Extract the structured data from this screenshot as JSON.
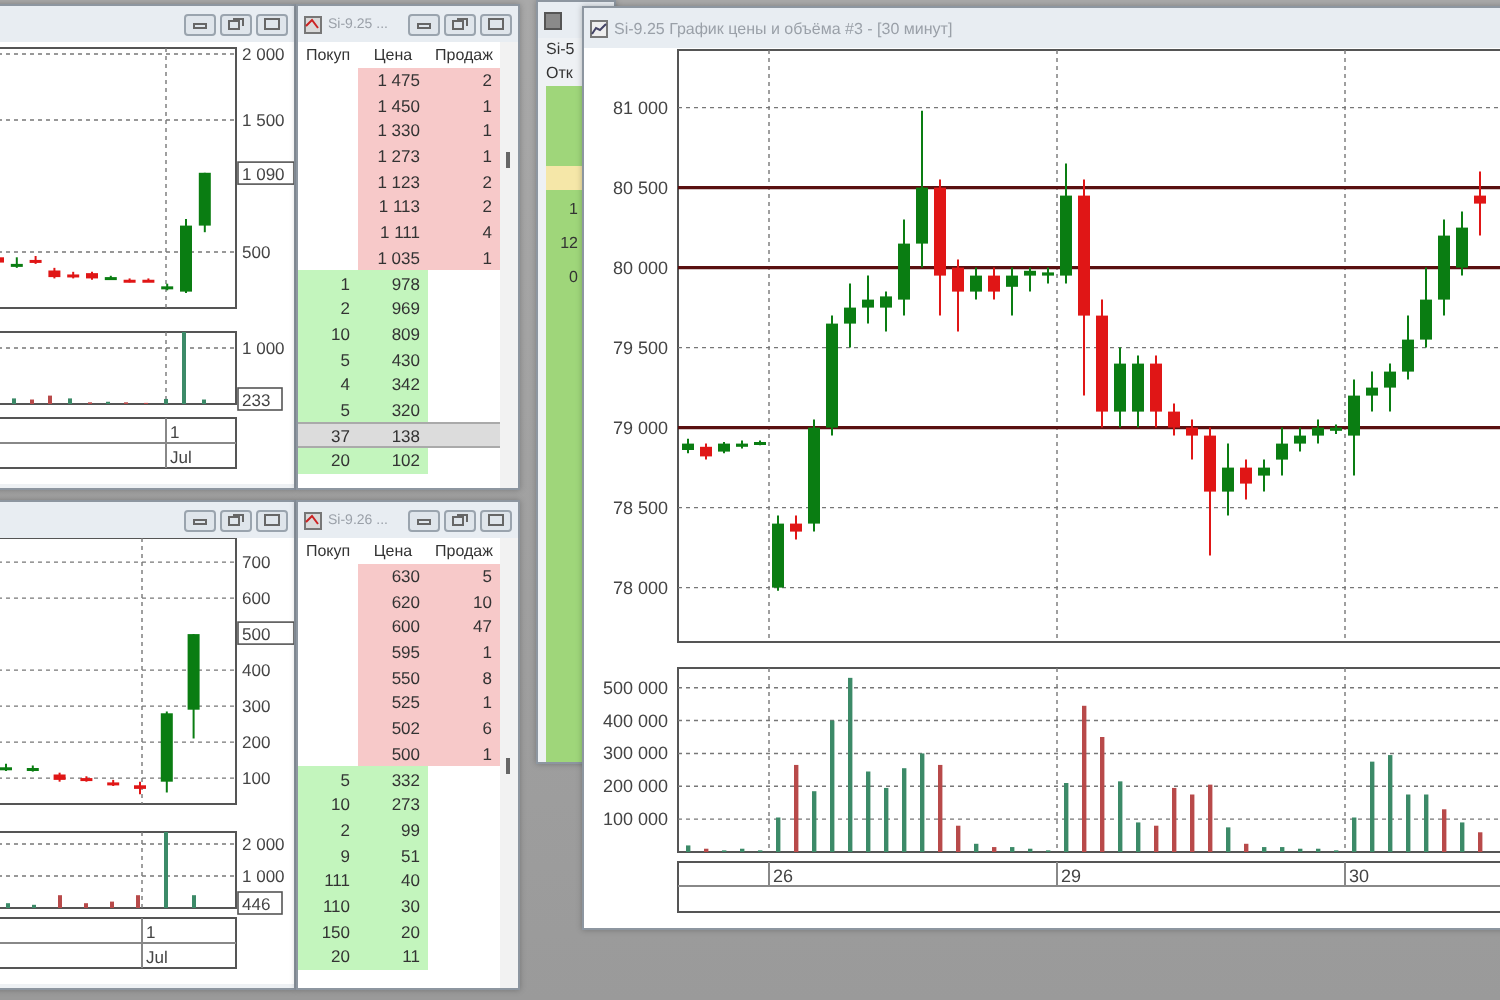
{
  "chart_windows": [
    {
      "chart_data": {
        "type": "candlestick",
        "grid": true,
        "categories": [
          null,
          null,
          null,
          null,
          null,
          null,
          null,
          null,
          null,
          null,
          null,
          null
        ],
        "ylim": [
          76,
          2045
        ],
        "yticks": [
          {
            "value": 2000,
            "label": "2 000"
          },
          {
            "value": 1500,
            "label": "1 500"
          },
          {
            "value": 500,
            "label": "500"
          }
        ],
        "ohlc": [
          [
            460,
            480,
            400,
            420
          ],
          [
            400,
            460,
            380,
            410
          ],
          [
            440,
            470,
            410,
            420
          ],
          [
            360,
            380,
            300,
            310
          ],
          [
            330,
            350,
            300,
            310
          ],
          [
            340,
            350,
            290,
            300
          ],
          [
            300,
            320,
            300,
            310
          ],
          [
            290,
            300,
            270,
            280
          ],
          [
            290,
            300,
            275,
            280
          ],
          [
            230,
            260,
            210,
            240
          ],
          [
            200,
            750,
            190,
            700
          ],
          [
            700,
            1100,
            650,
            1100
          ]
        ]
      },
      "last_price": "1 090",
      "volume_axis": [
        "1 000"
      ],
      "last_volume": "233",
      "date_labels": [
        "1",
        "Jul"
      ]
    },
    {
      "chart_data": {
        "type": "candlestick",
        "grid": true,
        "categories": [
          null,
          null,
          null,
          null,
          null,
          null,
          null,
          null
        ],
        "ylim": [
          28,
          767
        ],
        "yticks": [
          {
            "value": 700,
            "label": "700"
          },
          {
            "value": 600,
            "label": "600"
          },
          {
            "value": 400,
            "label": "400"
          },
          {
            "value": 300,
            "label": "300"
          },
          {
            "value": 200,
            "label": "200"
          },
          {
            "value": 100,
            "label": "100"
          }
        ],
        "ohlc": [
          [
            125,
            140,
            120,
            130
          ],
          [
            122,
            135,
            118,
            128
          ],
          [
            110,
            115,
            90,
            95
          ],
          [
            100,
            105,
            90,
            95
          ],
          [
            88,
            95,
            78,
            85
          ],
          [
            80,
            90,
            55,
            70
          ],
          [
            90,
            285,
            60,
            280
          ],
          [
            290,
            500,
            210,
            500
          ]
        ]
      },
      "last_price": "500",
      "volume_axis": [
        "2 000",
        "1 000"
      ],
      "last_volume": "446",
      "date_labels": [
        "1",
        "Jul"
      ]
    }
  ],
  "order_books": [
    {
      "title": "Si-9.25 ...",
      "columns": [
        "Покуп",
        "Цена",
        "Продаж"
      ],
      "rows": [
        {
          "kind": "ask",
          "price": "1 475",
          "sell": "2",
          "selected": false
        },
        {
          "kind": "ask",
          "price": "1 450",
          "sell": "1",
          "selected": false
        },
        {
          "kind": "ask",
          "price": "1 330",
          "sell": "1",
          "selected": false
        },
        {
          "kind": "ask",
          "price": "1 273",
          "sell": "1",
          "selected": false
        },
        {
          "kind": "ask",
          "price": "1 123",
          "sell": "2",
          "selected": false
        },
        {
          "kind": "ask",
          "price": "1 113",
          "sell": "2",
          "selected": false
        },
        {
          "kind": "ask",
          "price": "1 111",
          "sell": "4",
          "selected": false
        },
        {
          "kind": "ask",
          "price": "1 035",
          "sell": "1",
          "selected": false
        },
        {
          "kind": "bid",
          "buy": "1",
          "price": "978",
          "selected": false
        },
        {
          "kind": "bid",
          "buy": "2",
          "price": "969",
          "selected": false
        },
        {
          "kind": "bid",
          "buy": "10",
          "price": "809",
          "selected": false
        },
        {
          "kind": "bid",
          "buy": "5",
          "price": "430",
          "selected": false
        },
        {
          "kind": "bid",
          "buy": "4",
          "price": "342",
          "selected": false
        },
        {
          "kind": "bid",
          "buy": "5",
          "price": "320",
          "selected": false
        },
        {
          "kind": "bid",
          "buy": "37",
          "price": "138",
          "selected": true
        },
        {
          "kind": "bid",
          "buy": "20",
          "price": "102",
          "selected": false
        }
      ]
    },
    {
      "title": "Si-9.26 ...",
      "columns": [
        "Покуп",
        "Цена",
        "Продаж"
      ],
      "rows": [
        {
          "kind": "ask",
          "price": "630",
          "sell": "5",
          "selected": false
        },
        {
          "kind": "ask",
          "price": "620",
          "sell": "10",
          "selected": false
        },
        {
          "kind": "ask",
          "price": "600",
          "sell": "47",
          "selected": false
        },
        {
          "kind": "ask",
          "price": "595",
          "sell": "1",
          "selected": false
        },
        {
          "kind": "ask",
          "price": "550",
          "sell": "8",
          "selected": false
        },
        {
          "kind": "ask",
          "price": "525",
          "sell": "1",
          "selected": false
        },
        {
          "kind": "ask",
          "price": "502",
          "sell": "6",
          "selected": false
        },
        {
          "kind": "ask",
          "price": "500",
          "sell": "1",
          "selected": false
        },
        {
          "kind": "bid",
          "buy": "5",
          "price": "332",
          "selected": false
        },
        {
          "kind": "bid",
          "buy": "10",
          "price": "273",
          "selected": false
        },
        {
          "kind": "bid",
          "buy": "2",
          "price": "99",
          "selected": false
        },
        {
          "kind": "bid",
          "buy": "9",
          "price": "51",
          "selected": false
        },
        {
          "kind": "bid",
          "buy": "111",
          "price": "40",
          "selected": false
        },
        {
          "kind": "bid",
          "buy": "110",
          "price": "30",
          "selected": false
        },
        {
          "kind": "bid",
          "buy": "150",
          "price": "20",
          "selected": false
        },
        {
          "kind": "bid",
          "buy": "20",
          "price": "11",
          "selected": false
        }
      ]
    }
  ],
  "back_window": {
    "title": "Si-5",
    "header": "Отк",
    "cells": [
      "1",
      "12",
      "0"
    ]
  },
  "main_chart": {
    "title": "Si-9.25 График цены и объёма #3 - [30 минут]",
    "price": {
      "chart_data": {
        "type": "candlestick",
        "grid": true,
        "categories": [
          null,
          null,
          null,
          null,
          null,
          null,
          null,
          null,
          null,
          null,
          null,
          null,
          null,
          null,
          null,
          null,
          null,
          null,
          null,
          null,
          null,
          null,
          null,
          null,
          null,
          null,
          null,
          null,
          null,
          null,
          null,
          null,
          null,
          null,
          null,
          null,
          null,
          null,
          null,
          null,
          null,
          null,
          null,
          null,
          null
        ],
        "ylim": [
          77660,
          81360
        ],
        "yticks": [
          {
            "value": 81000,
            "label": "81 000"
          },
          {
            "value": 80500,
            "label": "80 500"
          },
          {
            "value": 80000,
            "label": "80 000"
          },
          {
            "value": 79500,
            "label": "79 500"
          },
          {
            "value": 79000,
            "label": "79 000"
          },
          {
            "value": 78500,
            "label": "78 500"
          },
          {
            "value": 78000,
            "label": "78 000"
          }
        ],
        "ohlc": [
          [
            78860,
            78930,
            78840,
            78900
          ],
          [
            78880,
            78900,
            78800,
            78820
          ],
          [
            78850,
            78910,
            78840,
            78900
          ],
          [
            78880,
            78920,
            78870,
            78900
          ],
          [
            78900,
            78920,
            78890,
            78910
          ],
          [
            78000,
            78450,
            77980,
            78400
          ],
          [
            78400,
            78450,
            78300,
            78350
          ],
          [
            78400,
            79050,
            78350,
            79000
          ],
          [
            79000,
            79700,
            78950,
            79650
          ],
          [
            79650,
            79900,
            79500,
            79750
          ],
          [
            79750,
            79950,
            79650,
            79800
          ],
          [
            79750,
            79850,
            79600,
            79820
          ],
          [
            79800,
            80300,
            79700,
            80150
          ],
          [
            80150,
            80980,
            80000,
            80500
          ],
          [
            80500,
            80550,
            79700,
            79950
          ],
          [
            80000,
            80050,
            79600,
            79850
          ],
          [
            79850,
            80000,
            79800,
            79950
          ],
          [
            79950,
            80000,
            79800,
            79850
          ],
          [
            79880,
            80000,
            79700,
            79950
          ],
          [
            79950,
            80000,
            79850,
            79980
          ],
          [
            79950,
            80000,
            79900,
            79970
          ],
          [
            79950,
            80650,
            79900,
            80450
          ],
          [
            80450,
            80550,
            79200,
            79700
          ],
          [
            79700,
            79800,
            79000,
            79100
          ],
          [
            79100,
            79500,
            79000,
            79400
          ],
          [
            79100,
            79450,
            79000,
            79400
          ],
          [
            79400,
            79450,
            79000,
            79100
          ],
          [
            79100,
            79150,
            78950,
            79000
          ],
          [
            79000,
            79050,
            78800,
            78950
          ],
          [
            78950,
            79000,
            78200,
            78600
          ],
          [
            78600,
            78900,
            78450,
            78750
          ],
          [
            78750,
            78800,
            78550,
            78650
          ],
          [
            78700,
            78800,
            78600,
            78750
          ],
          [
            78800,
            79000,
            78700,
            78900
          ],
          [
            78900,
            79000,
            78850,
            78950
          ],
          [
            78950,
            79050,
            78900,
            79000
          ],
          [
            78980,
            79020,
            78960,
            79000
          ],
          [
            78950,
            79300,
            78700,
            79200
          ],
          [
            79200,
            79350,
            79100,
            79250
          ],
          [
            79250,
            79400,
            79100,
            79350
          ],
          [
            79350,
            79700,
            79300,
            79550
          ],
          [
            79550,
            80000,
            79500,
            79800
          ],
          [
            79800,
            80300,
            79700,
            80200
          ],
          [
            80000,
            80350,
            79950,
            80250
          ],
          [
            80450,
            80600,
            80200,
            80400
          ]
        ]
      }
    },
    "volume": {
      "chart_data": {
        "type": "bar",
        "grid": true,
        "categories": [
          null,
          null,
          null,
          null,
          null,
          "26",
          null,
          null,
          null,
          null,
          null,
          null,
          null,
          null,
          null,
          null,
          null,
          null,
          null,
          null,
          null,
          "29",
          null,
          null,
          null,
          null,
          null,
          null,
          null,
          null,
          null,
          null,
          null,
          null,
          null,
          null,
          null,
          "30",
          null,
          null,
          null,
          null,
          null,
          null,
          null
        ],
        "ylim": [
          0,
          560000
        ],
        "yticks": [
          {
            "value": 100000,
            "label": "100 000"
          },
          {
            "value": 200000,
            "label": "200 000"
          },
          {
            "value": 300000,
            "label": "300 000"
          },
          {
            "value": 400000,
            "label": "400 000"
          },
          {
            "value": 500000,
            "label": "500 000"
          }
        ],
        "series": [
          {
            "color": "#3c8a68",
            "values": [
              20000,
              null,
              5000,
              10000,
              5000,
              105000,
              null,
              185000,
              400000,
              530000,
              245000,
              195000,
              255000,
              300000,
              null,
              null,
              25000,
              null,
              15000,
              10000,
              5000,
              210000,
              null,
              null,
              215000,
              90000,
              null,
              null,
              null,
              null,
              75000,
              null,
              15000,
              15000,
              10000,
              10000,
              5000,
              105000,
              275000,
              295000,
              175000,
              175000,
              null,
              90000,
              null
            ]
          },
          {
            "color": "#b84a4a",
            "values": [
              null,
              10000,
              null,
              null,
              null,
              null,
              265000,
              null,
              null,
              null,
              null,
              null,
              null,
              null,
              265000,
              80000,
              null,
              15000,
              null,
              null,
              null,
              null,
              445000,
              350000,
              null,
              null,
              80000,
              195000,
              175000,
              205000,
              null,
              25000,
              null,
              null,
              null,
              null,
              null,
              null,
              null,
              null,
              null,
              null,
              130000,
              null,
              60000
            ]
          }
        ]
      }
    }
  }
}
